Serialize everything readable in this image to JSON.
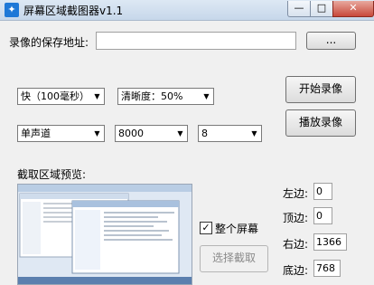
{
  "window": {
    "title": "屏幕区域截图器v1.1",
    "icon": "bird-icon"
  },
  "save": {
    "label": "录像的保存地址:",
    "path": "",
    "browse": "..."
  },
  "speed": {
    "selected": "快（100毫秒）"
  },
  "quality": {
    "selected": "清晰度：50%"
  },
  "channel": {
    "selected": "单声道"
  },
  "sample_rate": {
    "selected": "8000"
  },
  "bits": {
    "selected": "8"
  },
  "buttons": {
    "start_record": "开始录像",
    "play_record": "播放录像",
    "select_region": "选择截取"
  },
  "preview": {
    "label": "截取区域预览:"
  },
  "fullscreen": {
    "label": "整个屏幕",
    "checked": "✓"
  },
  "coords": {
    "left_label": "左边:",
    "left": "0",
    "top_label": "顶边:",
    "top": "0",
    "right_label": "右边:",
    "right": "1366",
    "bottom_label": "底边:",
    "bottom": "768"
  }
}
